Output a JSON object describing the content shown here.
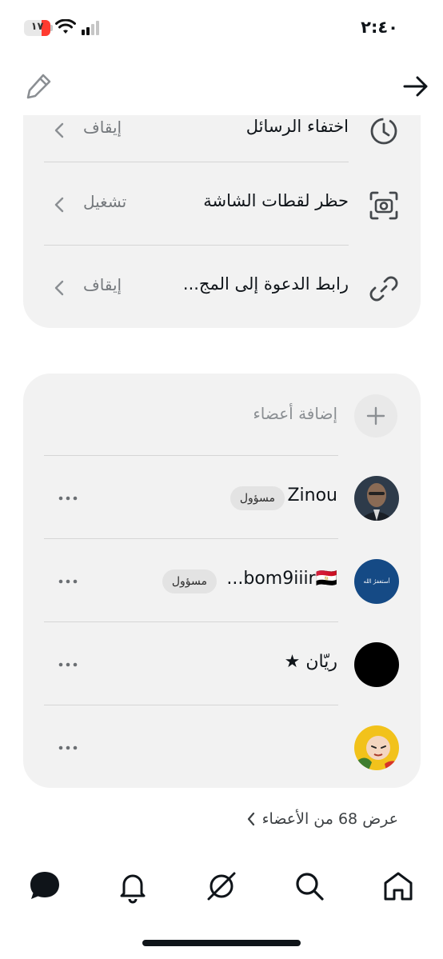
{
  "status_bar": {
    "time": "٢:٤٠",
    "battery_level": "١٧",
    "battery_color": "#ff3b30"
  },
  "header": {
    "edit_icon": "pencil-icon",
    "forward_icon": "arrow-right-icon"
  },
  "settings": {
    "rows": [
      {
        "title": "اختفاء الرسائل",
        "value": "إيقاف",
        "icon": "timer-icon"
      },
      {
        "title": "حظر لقطات الشاشة",
        "value": "تشغيل",
        "icon": "screenshot-camera-icon"
      },
      {
        "title": "رابط الدعوة إلى المج...",
        "value": "إيقاف",
        "icon": "link-icon"
      }
    ]
  },
  "members": {
    "add_label": "إضافة أعضاء",
    "list": [
      {
        "name": "Zinou",
        "badge": "مسؤول"
      },
      {
        "name": "...bom9iiir🇪🇬",
        "badge": "مسؤول",
        "avatar_text": "أستغفرُ الله"
      },
      {
        "name": "ريّان ★",
        "badge": ""
      },
      {
        "name": "",
        "badge": ""
      }
    ],
    "show_all": "عرض 68 من الأعضاء"
  },
  "tabs": [
    {
      "icon": "chat-bubble-icon",
      "active": true
    },
    {
      "icon": "bell-icon",
      "active": false
    },
    {
      "icon": "slashed-circle-icon",
      "active": false
    },
    {
      "icon": "search-icon",
      "active": false
    },
    {
      "icon": "home-icon",
      "active": false
    }
  ],
  "colors": {
    "card_bg": "#f2f2f2",
    "text": "#0f1419",
    "muted": "#75797d"
  }
}
